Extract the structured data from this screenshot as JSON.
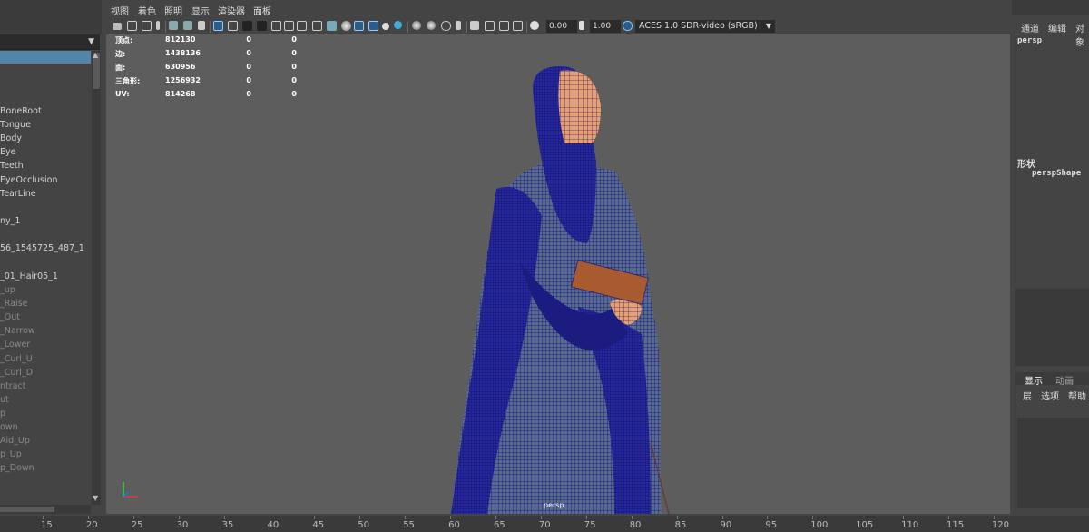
{
  "menu": [
    "视图",
    "着色",
    "照明",
    "显示",
    "渲染器",
    "面板"
  ],
  "toolbar": {
    "exposure_value": "0.00",
    "gamma_value": "1.00",
    "color_space": "ACES 1.0 SDR-video (sRGB)"
  },
  "hud": {
    "rows": [
      {
        "label": "顶点:",
        "total": "812130",
        "sel": "0",
        "comp": "0"
      },
      {
        "label": "边:",
        "total": "1438136",
        "sel": "0",
        "comp": "0"
      },
      {
        "label": "面:",
        "total": "630956",
        "sel": "0",
        "comp": "0"
      },
      {
        "label": "三角形:",
        "total": "1256932",
        "sel": "0",
        "comp": "0"
      },
      {
        "label": "UV:",
        "total": "814268",
        "sel": "0",
        "comp": "0"
      }
    ],
    "camera_label": "persp"
  },
  "outliner": {
    "items": [
      {
        "label": "BoneRoot",
        "dim": false
      },
      {
        "label": "Tongue",
        "dim": false
      },
      {
        "label": "Body",
        "dim": false
      },
      {
        "label": "Eye",
        "dim": false
      },
      {
        "label": "Teeth",
        "dim": false
      },
      {
        "label": "EyeOcclusion",
        "dim": false
      },
      {
        "label": "TearLine",
        "dim": false
      },
      {
        "label": "ny_1",
        "dim": false
      },
      {
        "label": "56_1545725_487_1",
        "dim": false
      },
      {
        "label": "_01_Hair05_1",
        "dim": false
      },
      {
        "label": "_up",
        "dim": true
      },
      {
        "label": "_Raise",
        "dim": true
      },
      {
        "label": "_Out",
        "dim": true
      },
      {
        "label": "_Narrow",
        "dim": true
      },
      {
        "label": "_Lower",
        "dim": true
      },
      {
        "label": "_Curl_U",
        "dim": true
      },
      {
        "label": "_Curl_D",
        "dim": true
      },
      {
        "label": "ntract",
        "dim": true
      },
      {
        "label": "ut",
        "dim": true
      },
      {
        "label": "p",
        "dim": true
      },
      {
        "label": "own",
        "dim": true
      },
      {
        "label": "Aid_Up",
        "dim": true
      },
      {
        "label": "p_Up",
        "dim": true
      },
      {
        "label": "p_Down",
        "dim": true
      }
    ]
  },
  "right": {
    "tabs": [
      "通道",
      "编辑",
      "对象"
    ],
    "object_name": "persp",
    "shape_header": "形状",
    "shape_name": "perspShape",
    "layer_tabs": [
      "显示",
      "动画"
    ],
    "layer_menu": [
      "层",
      "选项",
      "帮助"
    ]
  },
  "timeline": {
    "ticks": [
      "15",
      "20",
      "25",
      "30",
      "35",
      "40",
      "45",
      "50",
      "55",
      "60",
      "65",
      "70",
      "75",
      "80",
      "85",
      "90",
      "95",
      "100",
      "105",
      "110",
      "115",
      "120"
    ]
  },
  "colors": {
    "wire": "#1a1aa0",
    "skin": "#e8a070",
    "viewport_bg": "#5d5d5d",
    "selection": "#5285a6"
  }
}
